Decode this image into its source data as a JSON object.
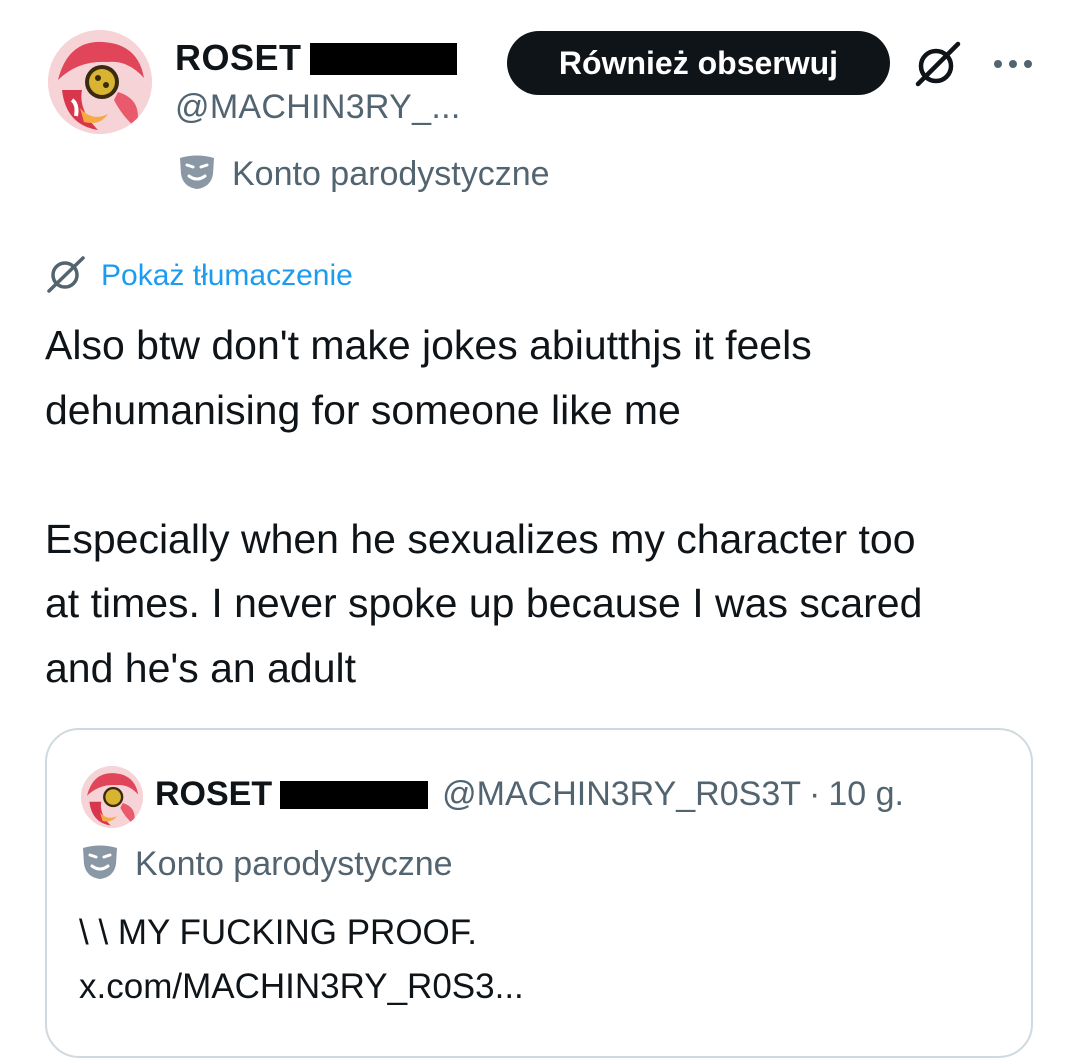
{
  "tweet": {
    "author": {
      "display_name": "ROSET",
      "handle": "@MACHIN3RY_..."
    },
    "follow_button_label": "Również obserwuj",
    "parody_label": "Konto parodystyczne",
    "translate_label": "Pokaż tłumaczenie",
    "body": {
      "line1": "Also btw don't make jokes abiutthjs it feels",
      "line2": "dehumanising for someone like me",
      "line3": "Especially when he sexualizes my character too",
      "line4": "at times. I never spoke up because I was scared",
      "line5": "and he's an adult"
    },
    "icons": {
      "grok": "grok-icon",
      "more": "more-options-icon",
      "parody": "theater-mask-icon",
      "translate": "translate-icon"
    }
  },
  "quote": {
    "display_name": "ROSET",
    "handle": "@MACHIN3RY_R0S3T",
    "separator": "·",
    "time": "10 g.",
    "parody_label": "Konto parodystyczne",
    "text_line1": "\\ \\ MY FUCKING PROOF.",
    "text_line2": "x.com/MACHIN3RY_R0S3..."
  },
  "colors": {
    "text_primary": "#0f1419",
    "text_secondary": "#536471",
    "link": "#1d9bf0",
    "border": "#cfd9de",
    "button_bg": "#0f1419"
  }
}
